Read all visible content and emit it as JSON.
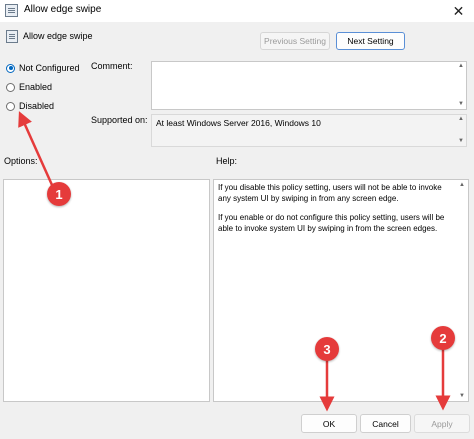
{
  "window": {
    "title": "Allow edge swipe",
    "close_glyph": "✕"
  },
  "header": {
    "title": "Allow edge swipe",
    "prev_label": "Previous Setting",
    "next_label": "Next Setting"
  },
  "state": {
    "options": [
      "Not Configured",
      "Enabled",
      "Disabled"
    ],
    "selected": "Not Configured"
  },
  "comment": {
    "label": "Comment:",
    "value": ""
  },
  "supported": {
    "label": "Supported on:",
    "value": "At least Windows Server 2016, Windows 10"
  },
  "options_panel": {
    "label": "Options:"
  },
  "help_panel": {
    "label": "Help:",
    "paragraphs": [
      "If you disable this policy setting, users will not be able to invoke any system UI by swiping in from any screen edge.",
      "If you enable or do not configure this policy setting, users will be able to invoke system UI by swiping in from the screen edges."
    ]
  },
  "footer": {
    "ok_label": "OK",
    "cancel_label": "Cancel",
    "apply_label": "Apply"
  },
  "annotations": {
    "badges": [
      "1",
      "2",
      "3"
    ],
    "color": "#e53b3b"
  },
  "icons": {
    "window_icon": "policy-document-icon",
    "header_icon": "policy-document-icon"
  },
  "colors": {
    "accent": "#0067c0",
    "annotation": "#e53b3b"
  }
}
